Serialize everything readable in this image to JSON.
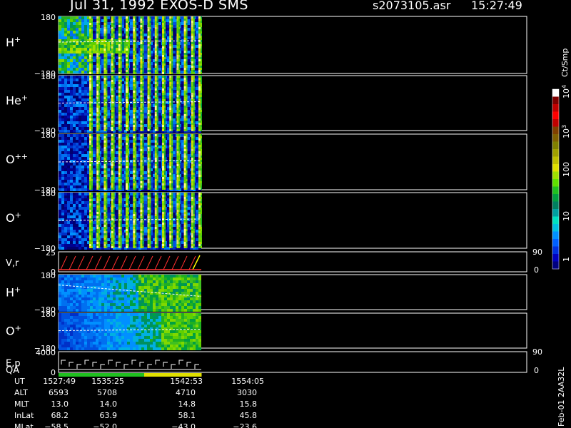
{
  "header": {
    "date_instrument": "Jul 31, 1992   EXOS-D SMS",
    "file": "s2073105.asr",
    "time": "15:27:49"
  },
  "panels": [
    {
      "id": "h1",
      "label": "H",
      "sup": "+",
      "ytop": "180",
      "ybot": "−180"
    },
    {
      "id": "he",
      "label": "He",
      "sup": "+",
      "ytop": "180",
      "ybot": "−180"
    },
    {
      "id": "opp",
      "label": "O",
      "sup": "++",
      "ytop": "180",
      "ybot": "−180"
    },
    {
      "id": "o1",
      "label": "O",
      "sup": "+",
      "ytop": "180",
      "ybot": "−180"
    },
    {
      "id": "vr",
      "label": "V,r",
      "sup": "",
      "ytop": "25",
      "ybot": "0",
      "rtop": "90",
      "rbot": "0"
    },
    {
      "id": "h2",
      "label": "H",
      "sup": "+",
      "ytop": "180",
      "ybot": "−180"
    },
    {
      "id": "o2",
      "label": "O",
      "sup": "+",
      "ytop": "180",
      "ybot": "−180"
    },
    {
      "id": "ep",
      "label": "E,p",
      "sup": "",
      "ytop": "4000",
      "ybot": "0",
      "rtop": "90",
      "rbot": "0",
      "label2": "QA"
    }
  ],
  "colorbar": {
    "title": "Ct/Smp",
    "ticks": [
      {
        "base": "10",
        "exp": "4"
      },
      {
        "base": "10",
        "exp": "3"
      },
      {
        "base": "100",
        "exp": ""
      },
      {
        "base": "10",
        "exp": ""
      },
      {
        "base": "1",
        "exp": ""
      }
    ],
    "colors": [
      "#000080",
      "#0000c0",
      "#0030e0",
      "#0060ff",
      "#0090ff",
      "#00c0e0",
      "#00e0c0",
      "#00a0a0",
      "#008060",
      "#00a040",
      "#20c020",
      "#60e000",
      "#a0e000",
      "#e0e000",
      "#c0c000",
      "#a0a000",
      "#808000",
      "#806000",
      "#804000",
      "#c00000",
      "#ff0000",
      "#c00000",
      "#800000",
      "#ffffff"
    ]
  },
  "ephemeris": {
    "rows": [
      {
        "label": "UT",
        "values": [
          "1527:49",
          "1535:25",
          "1542:53",
          "1554:05"
        ]
      },
      {
        "label": "ALT",
        "values": [
          "6593",
          "5708",
          "4710",
          "3030"
        ]
      },
      {
        "label": "MLT",
        "values": [
          "13.0",
          "14.0",
          "14.8",
          "15.8"
        ]
      },
      {
        "label": "InLat",
        "values": [
          "68.2",
          "63.9",
          "58.1",
          "45.8"
        ]
      },
      {
        "label": "MLat",
        "values": [
          "−58.5",
          "−52.0",
          "−43.0",
          "−23.6"
        ]
      }
    ]
  },
  "footer_note": "Feb-01 2AA32L",
  "chart_data": {
    "type": "heatmap",
    "title": "Jul 31, 1992   EXOS-D SMS",
    "x_ticks": [
      "1527:49",
      "1535:25",
      "1542:53",
      "1554:05"
    ],
    "panels": [
      {
        "name": "H+",
        "ylim": [
          -180,
          180
        ]
      },
      {
        "name": "He+",
        "ylim": [
          -180,
          180
        ]
      },
      {
        "name": "O++",
        "ylim": [
          -180,
          180
        ]
      },
      {
        "name": "O+",
        "ylim": [
          -180,
          180
        ]
      },
      {
        "name": "V,r",
        "ylim": [
          0,
          25
        ],
        "y2lim": [
          0,
          90
        ]
      },
      {
        "name": "H+",
        "ylim": [
          -180,
          180
        ]
      },
      {
        "name": "O+",
        "ylim": [
          -180,
          180
        ]
      },
      {
        "name": "E,p",
        "ylim": [
          0,
          4000
        ],
        "y2lim": [
          0,
          90
        ]
      }
    ],
    "colorbar": {
      "label": "Ct/Smp",
      "scale": "log",
      "range": [
        1,
        10000
      ]
    },
    "qa_bar": [
      "green",
      "green",
      "green",
      "yellow",
      "yellow"
    ]
  }
}
